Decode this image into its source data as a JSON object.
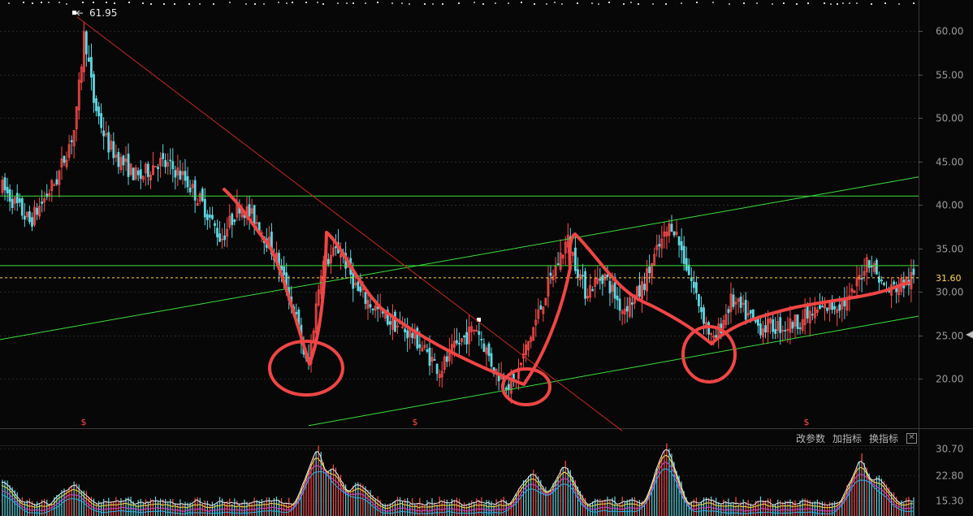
{
  "chart_data": [
    {
      "type": "candlestick",
      "panel": "price",
      "ylim": [
        14,
        64
      ],
      "y_ticks": [
        "60.00",
        "55.00",
        "50.00",
        "45.00",
        "40.00",
        "35.00",
        "30.00",
        "25.00",
        "20.00"
      ],
      "y_tick_values": [
        60,
        55,
        50,
        45,
        40,
        35,
        30,
        25,
        20
      ],
      "last_price": "31.60",
      "last_price_value": 31.6,
      "high_label": "61.95",
      "high_value": 61.95,
      "price_path": [
        [
          0,
          42
        ],
        [
          0.03,
          38
        ],
        [
          0.06,
          43
        ],
        [
          0.08,
          49
        ],
        [
          0.09,
          60
        ],
        [
          0.1,
          52
        ],
        [
          0.115,
          47
        ],
        [
          0.13,
          45
        ],
        [
          0.15,
          43
        ],
        [
          0.17,
          45
        ],
        [
          0.19,
          44
        ],
        [
          0.2,
          43
        ],
        [
          0.22,
          40
        ],
        [
          0.24,
          36
        ],
        [
          0.26,
          40
        ],
        [
          0.28,
          38
        ],
        [
          0.3,
          34
        ],
        [
          0.32,
          28
        ],
        [
          0.335,
          21
        ],
        [
          0.35,
          33
        ],
        [
          0.37,
          35
        ],
        [
          0.39,
          30
        ],
        [
          0.42,
          27
        ],
        [
          0.45,
          25
        ],
        [
          0.48,
          21
        ],
        [
          0.5,
          24
        ],
        [
          0.52,
          26
        ],
        [
          0.54,
          21
        ],
        [
          0.56,
          19
        ],
        [
          0.58,
          25
        ],
        [
          0.6,
          31
        ],
        [
          0.62,
          36
        ],
        [
          0.64,
          30
        ],
        [
          0.66,
          32
        ],
        [
          0.68,
          28
        ],
        [
          0.7,
          30
        ],
        [
          0.72,
          35
        ],
        [
          0.735,
          38
        ],
        [
          0.76,
          30
        ],
        [
          0.78,
          24
        ],
        [
          0.8,
          29
        ],
        [
          0.83,
          26
        ],
        [
          0.86,
          26
        ],
        [
          0.9,
          28
        ],
        [
          0.93,
          29
        ],
        [
          0.95,
          34
        ],
        [
          0.97,
          30
        ],
        [
          1.0,
          31.6
        ]
      ],
      "markers": [
        "$",
        "$",
        "$"
      ]
    },
    {
      "type": "line",
      "panel": "indicator",
      "ylim": [
        12,
        32
      ],
      "y_ticks": [
        "30.70",
        "22.80",
        "15.30"
      ],
      "y_tick_values": [
        30.7,
        22.8,
        15.3
      ]
    }
  ],
  "horizontal_levels": [
    41,
    33
  ],
  "indicator_buttons": [
    "改参数",
    "加指标",
    "换指标"
  ],
  "close_glyph": "✕",
  "expand_glyph": "◀",
  "colors": {
    "background": "#070707",
    "up": "#ff4b4b",
    "down": "#5fd6e0",
    "grid": "#2a2a2a",
    "channel": "#3adf3a",
    "trendline": "#c8281e",
    "annotation": "#f04545",
    "last_price": "#ffd54a",
    "indicator_lines": [
      "#e8e8e8",
      "#f2e04a",
      "#d445d4",
      "#2fb0e8"
    ]
  }
}
